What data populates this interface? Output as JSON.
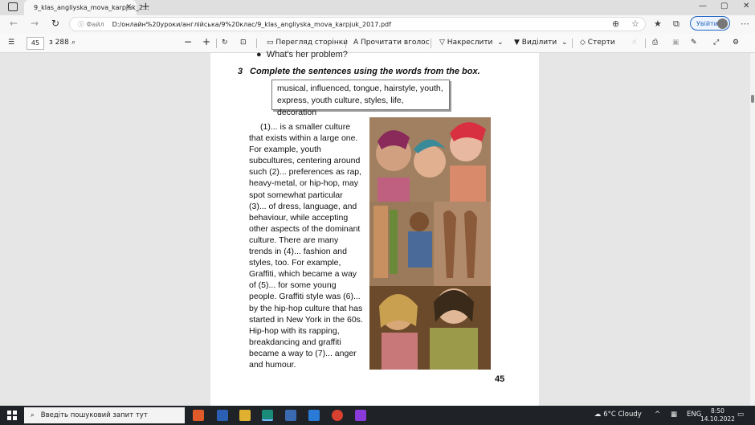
{
  "browser": {
    "tab_title": "9_klas_angliyska_mova_karpjuk_2...",
    "close": "✕",
    "new_tab": "+",
    "win_min": "—",
    "win_max": "▢",
    "win_close": "✕"
  },
  "address": {
    "file_label": "Файл",
    "url": "D:/онлайн%20уроки/англійська/9%20клас/9_klas_angliyska_mova_karpjuk_2017.pdf",
    "login_label": "Увійти"
  },
  "pdf_toolbar": {
    "page_number": "45",
    "page_total": "з 288",
    "page_view": "Перегляд сторінки",
    "read_aloud": "Прочитати вголос",
    "draw": "Накреслити",
    "highlight": "Виділити",
    "erase": "Стерти"
  },
  "page": {
    "prev_line": "What's her problem?",
    "exercise_num": "3",
    "exercise_heading": "Complete the sentences using the words from the box.",
    "box_line1": "musical, influenced, tongue, hairstyle, youth,",
    "box_line2": "express, youth culture, styles, life, decoration",
    "text_lines": [
      "(1)... is a smaller culture",
      "that exists within a large one.",
      "For example, youth",
      "subcultures, centering around",
      "such (2)... preferences as rap,",
      "heavy-metal, or hip-hop, may",
      "spot somewhat particular",
      "(3)... of dress, language, and",
      "behaviour, while accepting",
      "other aspects of the dominant",
      "culture. There are many",
      "trends in (4)... fashion and",
      "styles, too. For example,",
      "Graffiti, which became a way",
      "of (5)... for some young",
      "people. Graffiti style was (6)...",
      "by the hip-hop culture that has",
      "started in New York in the 60s.",
      "Hip-hop with its rapping,",
      "breakdancing and graffiti",
      "became a way to (7)... anger",
      "and humour."
    ],
    "page_number": "45"
  },
  "taskbar": {
    "search_placeholder": "Введіть пошуковий запит тут",
    "weather": "6°C Cloudy",
    "lang": "ENG",
    "time": "8:50",
    "date": "14.10.2022"
  }
}
